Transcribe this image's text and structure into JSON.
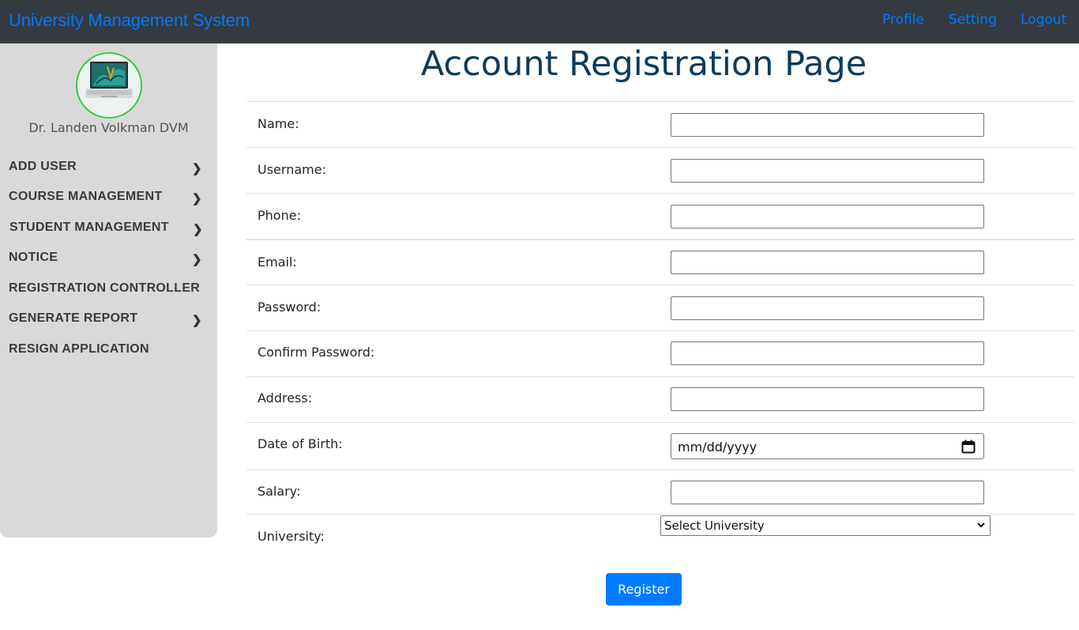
{
  "navbar": {
    "brand": "University Management System",
    "links": [
      "Profile",
      "Setting",
      "Logout"
    ],
    "background": "#343a40",
    "link_color": "#007bff"
  },
  "sidebar": {
    "user_name": "Dr. Landen Volkman DVM",
    "menu": [
      {
        "label": "ADD USER",
        "has_submenu": true
      },
      {
        "label": "COURSE MANAGEMENT",
        "has_submenu": true
      },
      {
        "label": "STUDENT MANAGEMENT",
        "has_submenu": true
      },
      {
        "label": "NOTICE",
        "has_submenu": true
      },
      {
        "label": "REGISTRATION CONTROLLER",
        "has_submenu": false
      },
      {
        "label": "GENERATE REPORT",
        "has_submenu": true
      },
      {
        "label": "RESIGN APPLICATION",
        "has_submenu": false
      }
    ],
    "chevron": "❯"
  },
  "main": {
    "title": "Account Registration Page",
    "fields": {
      "name": {
        "label": "Name:",
        "value": ""
      },
      "username": {
        "label": "Username:",
        "value": ""
      },
      "phone": {
        "label": "Phone:",
        "value": ""
      },
      "email": {
        "label": "Email:",
        "value": ""
      },
      "password": {
        "label": "Password:",
        "value": ""
      },
      "confirm_password": {
        "label": "Confirm Password:",
        "value": ""
      },
      "address": {
        "label": "Address:",
        "value": ""
      },
      "dob": {
        "label": "Date of Birth:",
        "placeholder": "mm/dd/yyyy"
      },
      "salary": {
        "label": "Salary:",
        "value": ""
      },
      "university": {
        "label": "University:",
        "selected": "Select University"
      }
    },
    "register_label": "Register",
    "accent_color": "#007bff",
    "title_color": "#0d3b5c"
  }
}
